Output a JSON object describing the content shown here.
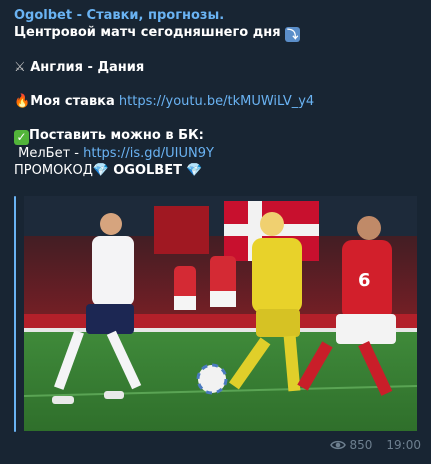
{
  "post": {
    "channel_name": "Ogolbet - Ставки, прогнозы.",
    "headline": "Центровой матч сегодняшнего дня",
    "match": "Англия - Дания",
    "bet_label": "Моя ставка",
    "bet_link": "https://youtu.be/tkMUWiLV_y4",
    "bookmaker_label": "Поставить можно в БК:",
    "bookmaker_line_prefix": "МелБет - ",
    "bookmaker_link": "https://is.gd/UIUN9Y",
    "promo_label": "ПРОМОКОД",
    "promo_code": "OGOLBET",
    "views": "850",
    "time": "19:00"
  },
  "icons": {
    "down_arrow": "arrow-down-emoji",
    "swords": "crossed-swords-emoji",
    "fire": "fire-emoji",
    "check": "check-mark-emoji",
    "gem": "gem-emoji",
    "views": "eye-icon"
  },
  "colors": {
    "background": "#0e1621",
    "bubble": "#182533",
    "link": "#6ab3f3",
    "meta": "#6d7f8f"
  }
}
